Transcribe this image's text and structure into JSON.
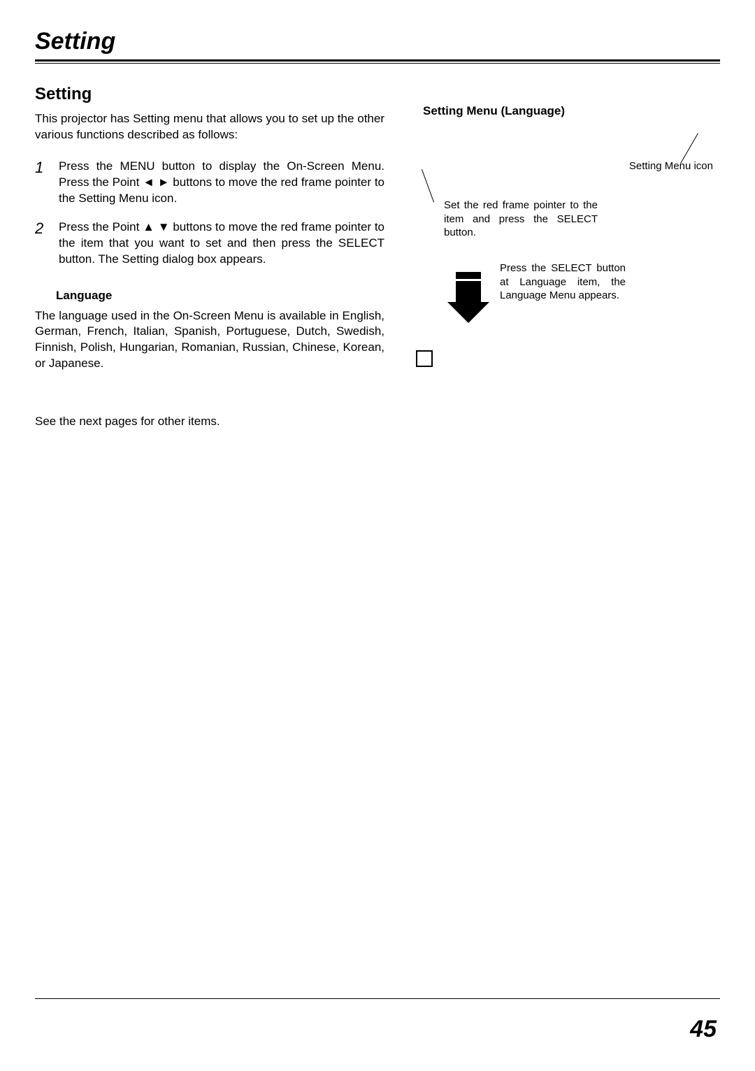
{
  "pageTitle": "Setting",
  "sectionHeading": "Setting",
  "intro": "This projector has Setting menu that allows you to set up the other various functions described as follows:",
  "steps": [
    {
      "num": "1",
      "text": "Press the MENU button to display the On-Screen Menu.  Press the Point ◄ ► buttons to move the red frame pointer to the Setting Menu icon."
    },
    {
      "num": "2",
      "text": "Press the Point ▲ ▼ buttons to move the red frame pointer to the item that you want to set and then press the SELECT button. The Setting dialog box appears."
    }
  ],
  "subheading": "Language",
  "languageText": "The language used in the On-Screen Menu is available in English, German, French, Italian, Spanish, Portuguese, Dutch, Swedish, Finnish, Polish, Hungarian, Romanian, Russian, Chinese, Korean, or Japanese.",
  "seeNext": "See the next pages for other items.",
  "rightHeading": "Setting Menu (Language)",
  "callout1": "Setting Menu icon",
  "callout2": "Set the red frame pointer to the item and press the SELECT button.",
  "callout3": "Press the SELECT button at Language item, the Language Menu appears.",
  "pageNumber": "45"
}
